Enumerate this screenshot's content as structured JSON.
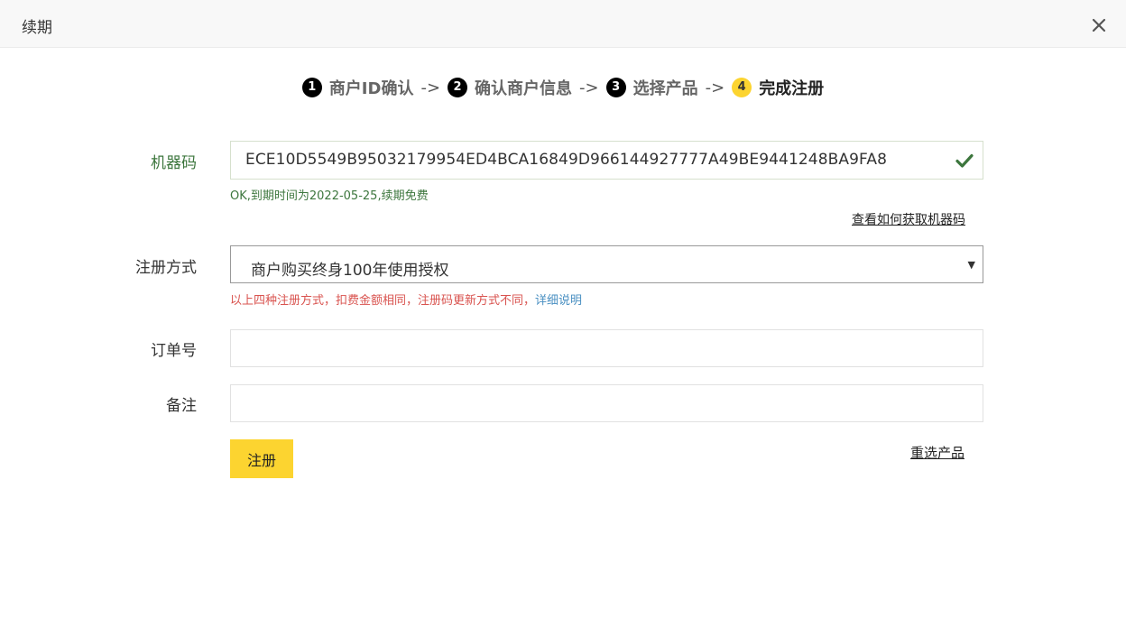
{
  "dialog": {
    "title": "续期"
  },
  "steps": [
    {
      "num": "1",
      "label": "商户ID确认"
    },
    {
      "num": "2",
      "label": "确认商户信息"
    },
    {
      "num": "3",
      "label": "选择产品"
    },
    {
      "num": "4",
      "label": "完成注册"
    }
  ],
  "arrow": "->",
  "active_step": 4,
  "form": {
    "machine_code": {
      "label": "机器码",
      "value": "ECE10D5549B95032179954ED4BCA16849D966144927777A49BE9441248BA9FA8",
      "status_text": "OK,到期时间为2022-05-25,续期免费",
      "help_link": "查看如何获取机器码"
    },
    "register_method": {
      "label": "注册方式",
      "selected": "商户购买终身100年使用授权",
      "hint": "以上四种注册方式，扣费金额相同，注册码更新方式不同，",
      "hint_link": "详细说明"
    },
    "order_no": {
      "label": "订单号",
      "value": ""
    },
    "remark": {
      "label": "备注",
      "value": ""
    },
    "submit_label": "注册",
    "reselect_label": "重选产品"
  },
  "colors": {
    "accent_yellow": "#fcd430",
    "success_green": "#3c763d",
    "warning_red": "#d9534f",
    "link_blue": "#4a90c2"
  }
}
